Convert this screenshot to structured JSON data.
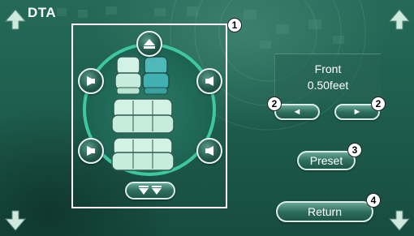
{
  "title": "DTA",
  "colors": {
    "background": "#1e5e4e",
    "ring": "#3fc7a0",
    "seat_fill": "#d2f2e6",
    "seat_selected": "#40b0b0",
    "frame": "#ffffff"
  },
  "position_panel": {
    "location": "Front",
    "distance": "0.50feet"
  },
  "buttons": {
    "prev_label": "◄",
    "next_label": "►",
    "preset_label": "Preset",
    "return_label": "Return"
  },
  "callouts": {
    "seat_area": "1",
    "arrows": "2",
    "preset": "3",
    "return": "4"
  },
  "icons": {
    "top_center": "triangle-up-icon",
    "bottom_center": "double-triangle-down-icon",
    "left": "speaker-left-icon",
    "right": "speaker-right-icon",
    "corners": "diamond-arrow-icon"
  },
  "seats": {
    "front_left_selected": false,
    "front_right_selected": true
  }
}
